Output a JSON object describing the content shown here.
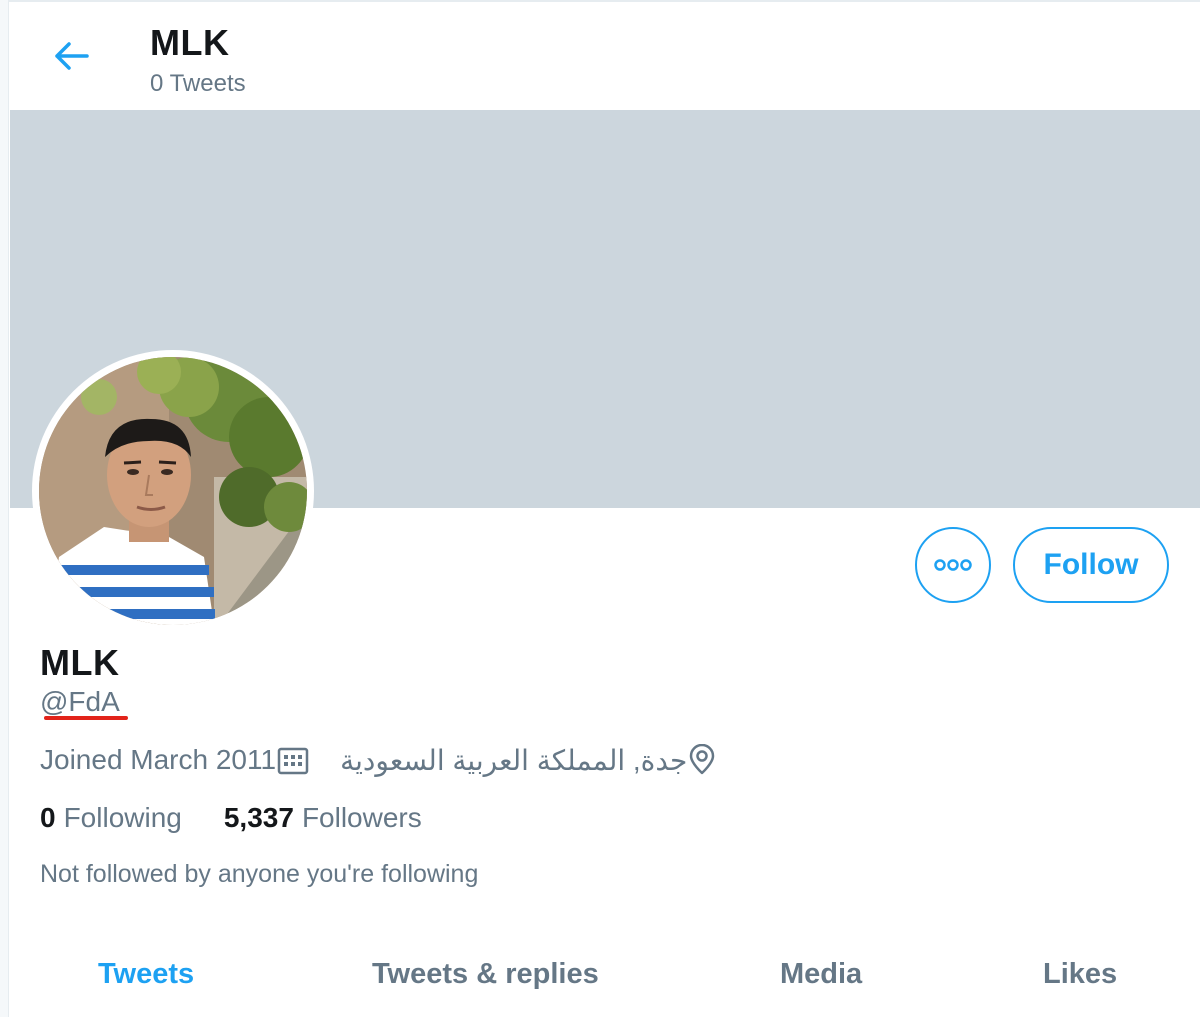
{
  "header": {
    "title": "MLK",
    "tweet_count": "0 Tweets"
  },
  "profile": {
    "name": "MLK",
    "handle": "@FdA",
    "joined": "Joined March 2011",
    "location": "جدة, المملكة العربية السعودية",
    "following_count": "0",
    "following_label": "Following",
    "followers_count": "5,337",
    "followers_label": "Followers",
    "not_followed": "Not followed by anyone you're following"
  },
  "actions": {
    "follow_label": "Follow"
  },
  "tabs": [
    {
      "label": "Tweets",
      "active": true
    },
    {
      "label": "Tweets & replies",
      "active": false
    },
    {
      "label": "Media",
      "active": false
    },
    {
      "label": "Likes",
      "active": false
    }
  ],
  "colors": {
    "accent": "#1da1f2",
    "banner": "#ccd6dd",
    "secondary_text": "#657786",
    "primary_text": "#14171a",
    "annotation_underline": "#e2231a"
  },
  "icons": {
    "back": "arrow-left-icon",
    "more": "more-dots-icon",
    "calendar": "calendar-icon",
    "location": "location-pin-icon"
  }
}
